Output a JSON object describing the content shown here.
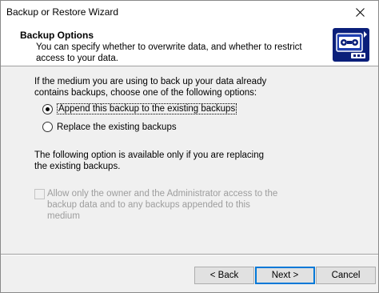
{
  "window": {
    "title": "Backup or Restore Wizard"
  },
  "header": {
    "title": "Backup Options",
    "description": "You can specify whether to overwrite data, and whether to restrict access to your data."
  },
  "content": {
    "intro_text": "If the medium you are using to back up your data already contains backups, choose one of the following options:",
    "options": [
      {
        "label": "Append this backup to the existing backups",
        "selected": true
      },
      {
        "label": "Replace the existing backups",
        "selected": false
      }
    ],
    "replace_note": "The following option is available only if you are replacing the existing backups.",
    "restrict_access": {
      "label": "Allow only the owner and the Administrator access to the backup data and to any backups appended to this medium",
      "checked": false,
      "enabled": false
    }
  },
  "buttons": {
    "back": "< Back",
    "next": "Next >",
    "cancel": "Cancel"
  },
  "icons": {
    "close": "close-icon",
    "header": "backup-tape-icon"
  },
  "colors": {
    "accent": "#0078d7",
    "icon_blue": "#0a1f7a",
    "disabled_text": "#9d9d9d"
  }
}
